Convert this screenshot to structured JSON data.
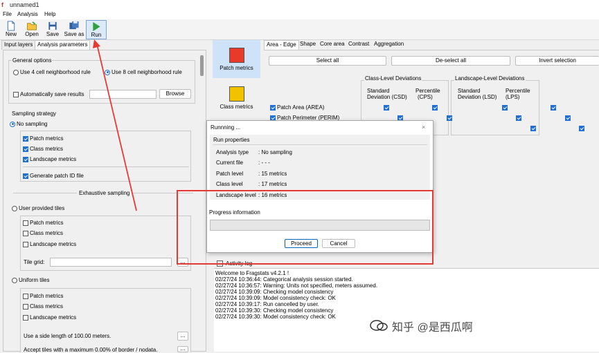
{
  "window": {
    "title": "unnamed1",
    "app_icon_text": "f"
  },
  "menu": [
    "File",
    "Analysis",
    "Help"
  ],
  "toolbar": [
    {
      "label": "New",
      "icon": "new-document-icon"
    },
    {
      "label": "Open",
      "icon": "open-folder-icon"
    },
    {
      "label": "Save",
      "icon": "save-disk-icon"
    },
    {
      "label": "Save as",
      "icon": "save-as-icon"
    },
    {
      "label": "Run",
      "icon": "run-play-icon"
    }
  ],
  "left_tabs": [
    "Input layers",
    "Analysis parameters"
  ],
  "general_options": {
    "title": "General options",
    "radio_4": "Use 4 cell neighborhood rule",
    "radio_8": "Use 8 cell neighborhood rule",
    "auto_save": "Automatically save results",
    "browse": "Browse"
  },
  "sampling": {
    "title": "Sampling strategy",
    "no_sampling": "No sampling",
    "patch_metrics": "Patch metrics",
    "class_metrics": "Class metrics",
    "landscape_metrics": "Landscape metrics",
    "generate_patch_id": "Generate patch ID file",
    "exhaustive": "Exhaustive sampling",
    "user_tiles": "User provided tiles",
    "tile_grid": "Tile grid:",
    "ellipsis": "...",
    "uniform_tiles": "Uniform tiles",
    "side_length": "Use a side length of 100.00 meters.",
    "accept_tiles": "Accept tiles with a maximum 0.00% of border / nodata."
  },
  "sidebar": [
    {
      "label": "Patch metrics",
      "color": "#e8392a"
    },
    {
      "label": "Class metrics",
      "color": "#f2c200"
    }
  ],
  "right_tabs": [
    "Area - Edge",
    "Shape",
    "Core area",
    "Contrast",
    "Aggregation"
  ],
  "right_buttons": {
    "select_all": "Select all",
    "deselect_all": "De-select all",
    "invert": "Invert selection"
  },
  "metrics": {
    "class_dev_title": "Class-Level Deviations",
    "land_dev_title": "Landscape-Level Deviations",
    "std_dev_label": "Standard",
    "deviation_csd": "Deviation   (CSD)",
    "percentile_label": "Percentile",
    "cps": "(CPS)",
    "deviation_lsd": "Deviation   (LSD)",
    "lps": "(LPS)",
    "rows": [
      "Patch Area  (AREA)",
      "Patch Perimeter  (PERIM)"
    ]
  },
  "dialog": {
    "title": "Runnning ...",
    "close": "×",
    "run_properties": "Run properties",
    "props": [
      {
        "key": "Analysis type",
        "value": ": No sampling"
      },
      {
        "key": "Current file",
        "value": ":     - - -"
      },
      {
        "key": "Patch level",
        "value": ": 15 metrics"
      },
      {
        "key": "Class level",
        "value": ": 17 metrics"
      },
      {
        "key": "Landscape level",
        "value": ": 16 metrics"
      }
    ],
    "progress_label": "Progress information",
    "progress_fraction": 0,
    "proceed": "Proceed",
    "cancel": "Cancel"
  },
  "activity": {
    "label": "Activity log",
    "lines": [
      "Welcome to Fragstats v4.2.1 !",
      "02/27/24 10:36:44: Categorical analysis session started.",
      "02/27/24 10:36:57: Warning: Units not specified, meters assumed.",
      "02/27/24 10:39:09: Checking model consistency",
      "02/27/24 10:39:09: Model consistency check: OK",
      "02/27/24 10:39:17: Run cancelled by user.",
      "02/27/24 10:39:30: Checking model consistency",
      "02/27/24 10:39:30: Model consistency check: OK"
    ]
  },
  "watermark": "知乎 @是西瓜啊",
  "colors": {
    "accent": "#1f6fd6",
    "annotation_red": "#e53935"
  }
}
